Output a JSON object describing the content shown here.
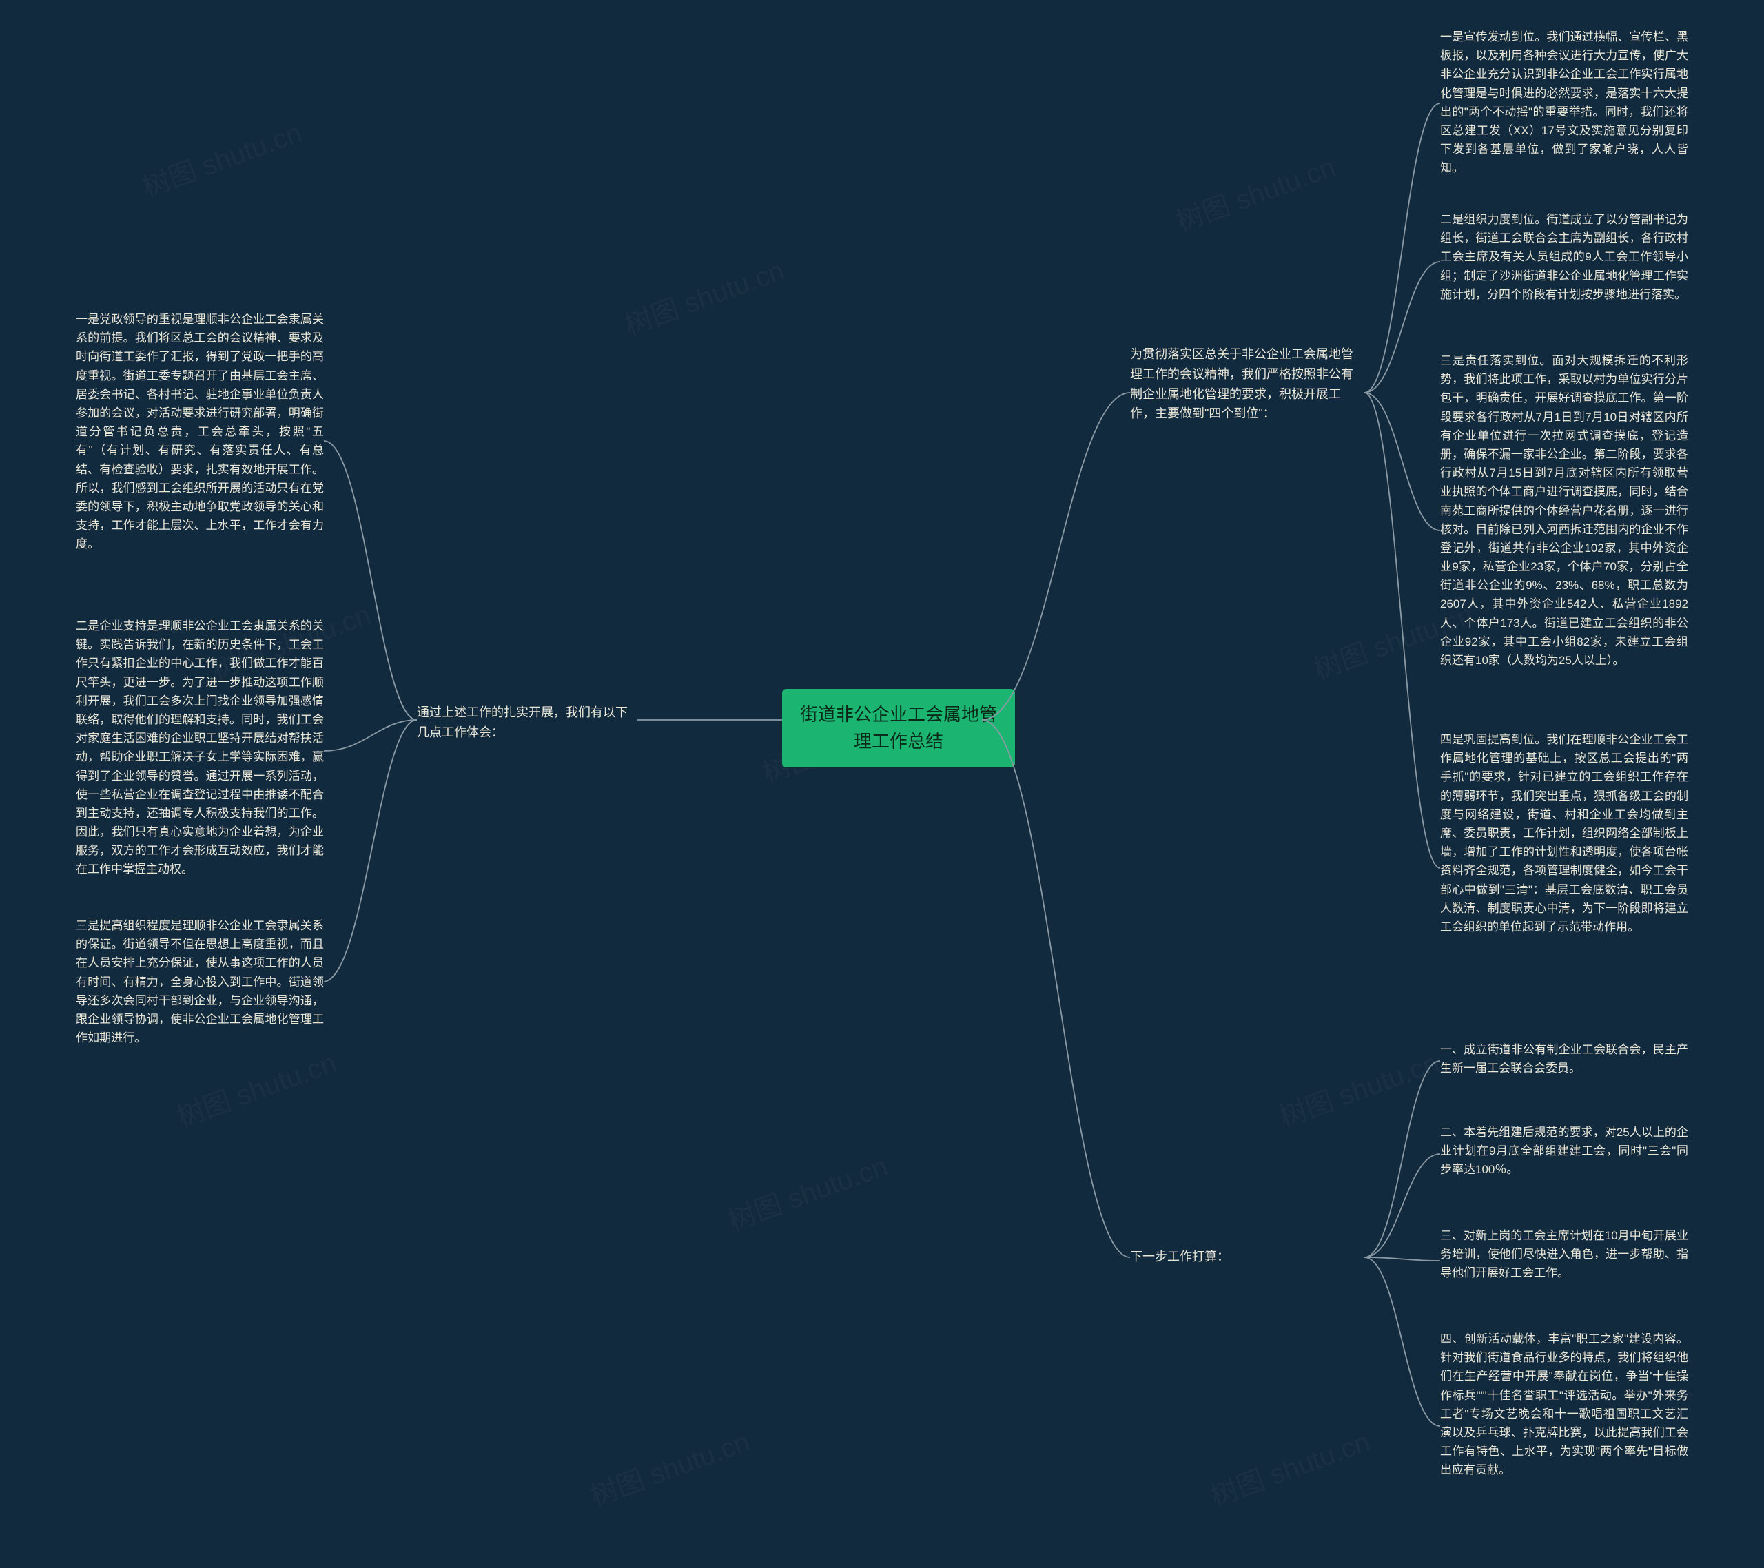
{
  "root": {
    "title": "街道非公企业工会属地管理工作总结"
  },
  "left_branch": {
    "label": "通过上述工作的扎实开展，我们有以下几点工作体会：",
    "items": [
      "一是党政领导的重视是理顺非公企业工会隶属关系的前提。我们将区总工会的会议精神、要求及时向街道工委作了汇报，得到了党政一把手的高度重视。街道工委专题召开了由基层工会主席、居委会书记、各村书记、驻地企事业单位负责人参加的会议，对活动要求进行研究部署，明确街道分管书记负总责，工会总牵头，按照\"五有\"（有计划、有研究、有落实责任人、有总结、有检查验收）要求，扎实有效地开展工作。所以，我们感到工会组织所开展的活动只有在党委的领导下，积极主动地争取党政领导的关心和支持，工作才能上层次、上水平，工作才会有力度。",
      "二是企业支持是理顺非公企业工会隶属关系的关键。实践告诉我们，在新的历史条件下，工会工作只有紧扣企业的中心工作，我们做工作才能百尺竿头，更进一步。为了进一步推动这项工作顺利开展，我们工会多次上门找企业领导加强感情联络，取得他们的理解和支持。同时，我们工会对家庭生活困难的企业职工坚持开展结对帮扶活动，帮助企业职工解决子女上学等实际困难，赢得到了企业领导的赞誉。通过开展一系列活动，使一些私营企业在调查登记过程中由推诿不配合到主动支持，还抽调专人积极支持我们的工作。因此，我们只有真心实意地为企业着想，为企业服务，双方的工作才会形成互动效应，我们才能在工作中掌握主动权。",
      "三是提高组织程度是理顺非公企业工会隶属关系的保证。街道领导不但在思想上高度重视，而且在人员安排上充分保证，使从事这项工作的人员有时间、有精力，全身心投入到工作中。街道领导还多次会同村干部到企业，与企业领导沟通，跟企业领导协调，使非公企业工会属地化管理工作如期进行。"
    ]
  },
  "right_branches": [
    {
      "label": "为贯彻落实区总关于非公企业工会属地管理工作的会议精神，我们严格按照非公有制企业属地化管理的要求，积极开展工作，主要做到\"四个到位\"：",
      "items": [
        "一是宣传发动到位。我们通过横幅、宣传栏、黑板报，以及利用各种会议进行大力宣传，使广大非公企业充分认识到非公企业工会工作实行属地化管理是与时俱进的必然要求，是落实十六大提出的\"两个不动摇\"的重要举措。同时，我们还将区总建工发（XX）17号文及实施意见分别复印下发到各基层单位，做到了家喻户晓，人人皆知。",
        "二是组织力度到位。街道成立了以分管副书记为组长，街道工会联合会主席为副组长，各行政村工会主席及有关人员组成的9人工会工作领导小组；制定了沙洲街道非公企业属地化管理工作实施计划，分四个阶段有计划按步骤地进行落实。",
        "三是责任落实到位。面对大规模拆迁的不利形势，我们将此项工作，采取以村为单位实行分片包干，明确责任，开展好调查摸底工作。第一阶段要求各行政村从7月1日到7月10日对辖区内所有企业单位进行一次拉网式调查摸底，登记造册，确保不漏一家非公企业。第二阶段，要求各行政村从7月15日到7月底对辖区内所有领取营业执照的个体工商户进行调查摸底，同时，结合南苑工商所提供的个体经营户花名册，逐一进行核对。目前除已列入河西拆迁范围内的企业不作登记外，街道共有非公企业102家，其中外资企业9家，私营企业23家，个体户70家，分别占全街道非公企业的9%、23%、68%，职工总数为2607人，其中外资企业542人、私营企业1892人、个体户173人。街道已建立工会组织的非公企业92家，其中工会小组82家，未建立工会组织还有10家（人数均为25人以上）。",
        "四是巩固提高到位。我们在理顺非公企业工会工作属地化管理的基础上，按区总工会提出的\"两手抓\"的要求，针对已建立的工会组织工作存在的薄弱环节，我们突出重点，狠抓各级工会的制度与网络建设，街道、村和企业工会均做到主席、委员职责，工作计划，组织网络全部制板上墙，增加了工作的计划性和透明度，使各项台帐资料齐全规范，各项管理制度健全，如今工会干部心中做到\"三清\"：基层工会底数清、职工会员人数清、制度职责心中清，为下一阶段即将建立工会组织的单位起到了示范带动作用。"
      ]
    },
    {
      "label": "下一步工作打算：",
      "items": [
        "一、成立街道非公有制企业工会联合会，民主产生新一届工会联合会委员。",
        "二、本着先组建后规范的要求，对25人以上的企业计划在9月底全部组建建工会，同时\"三会\"同步率达100％。",
        "三、对新上岗的工会主席计划在10月中旬开展业务培训，使他们尽快进入角色，进一步帮助、指导他们开展好工会工作。",
        "四、创新活动载体，丰富\"职工之家\"建设内容。针对我们街道食品行业多的特点，我们将组织他们在生产经营中开展\"奉献在岗位，争当'十佳操作标兵'\"\"十佳名誉职工\"评选活动。举办\"外来务工者\"专场文艺晚会和十一歌唱祖国职工文艺汇演以及乒乓球、扑克牌比赛，以此提高我们工会工作有特色、上水平，为实现\"两个率先\"目标做出应有贡献。"
      ]
    }
  ],
  "watermark": "树图 shutu.cn"
}
